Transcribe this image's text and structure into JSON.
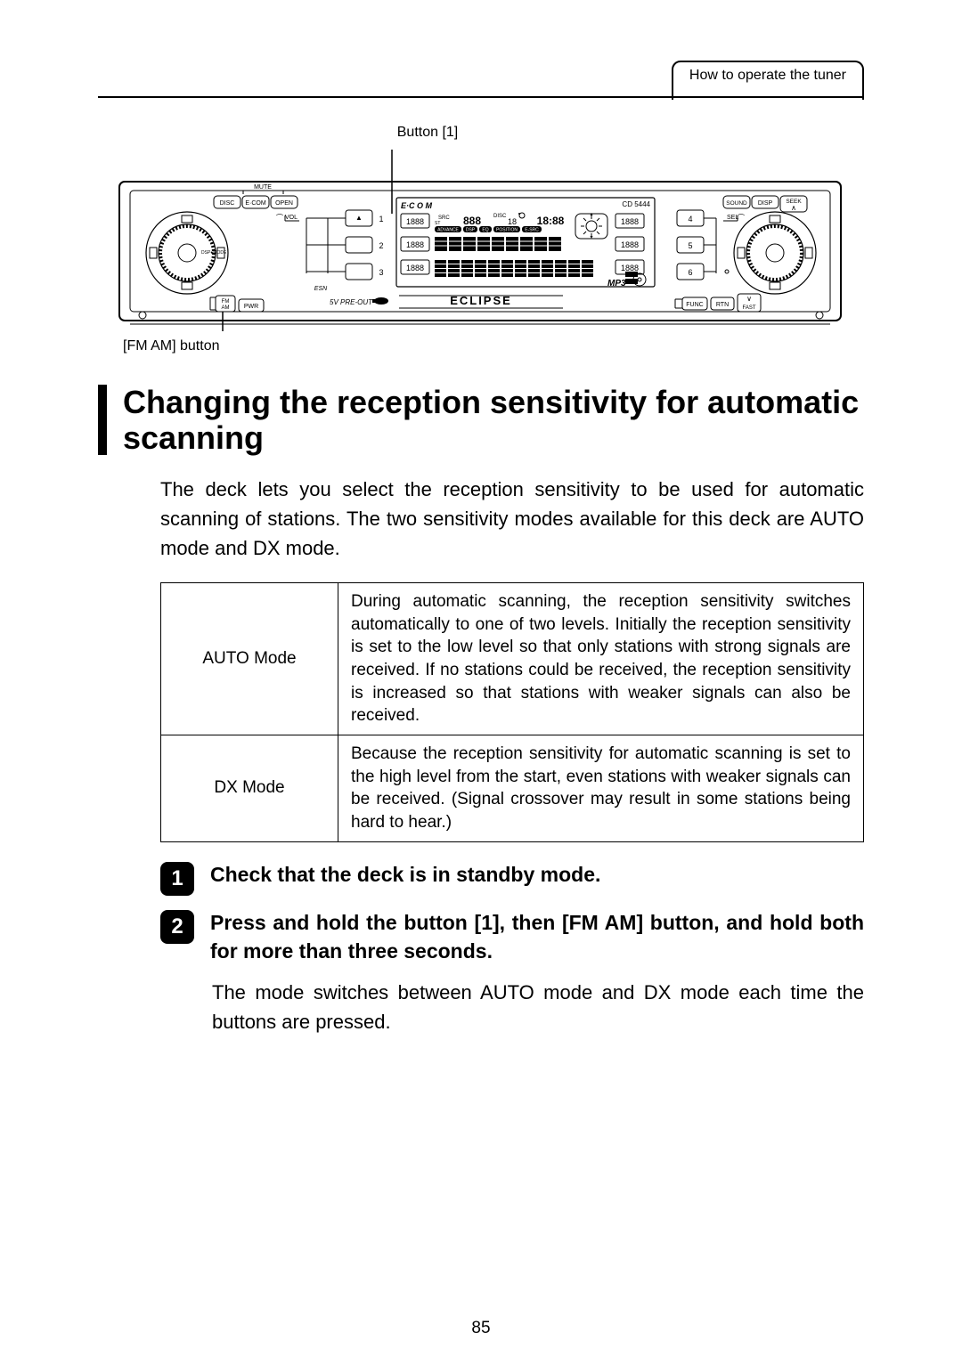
{
  "header": {
    "section_label": "How to operate the tuner"
  },
  "figure": {
    "top_label": "Button [1]",
    "bottom_label": "[FM AM] button",
    "device": {
      "model": "CD 5444",
      "brand": "ECLIPSE",
      "labels": {
        "mute": "MUTE",
        "disc": "DISC",
        "ecom": "E·COM",
        "open": "OPEN",
        "sound": "SOUND",
        "disp": "DISP",
        "seek_up": "SEEK",
        "vol": "VOL",
        "sel": "SEL",
        "esn": "ESN",
        "fm": "FM",
        "am": "AM",
        "pwr": "PWR",
        "preset1": "1",
        "preset2": "2",
        "preset3": "3",
        "preset4": "4",
        "preset5": "5",
        "preset6": "6",
        "eject_glyph": "▲",
        "preout": "5V PRE-OUT",
        "func": "FUNC",
        "rtn": "RTN",
        "fast": "FAST",
        "mp3": "MP3",
        "st": "ST",
        "src": "SRC",
        "disc_ind": "DISC",
        "advance": "ADVANCE",
        "dsp": "DSP",
        "eq": "EQ",
        "position": "POSITION",
        "esrc": "E-SRC",
        "lcd_time": "18:88",
        "lcd_seg": "1888"
      }
    }
  },
  "section_title": "Changing the reception sensitivity for automatic scanning",
  "intro": "The deck lets you select the reception sensitivity to be used for automatic scanning of stations. The two sensitivity modes available for this deck are AUTO mode and DX mode.",
  "modes": [
    {
      "name": "AUTO Mode",
      "description": "During automatic scanning, the reception sensitivity switches automatically to one of two levels. Initially the reception sensitivity is set to the low level so that only stations with strong signals are received. If no stations could be received, the reception sensitivity is increased so that stations with weaker signals can also be received."
    },
    {
      "name": "DX Mode",
      "description": "Because the reception sensitivity for automatic scanning is set to the high level from the start, even stations with weaker signals can be received. (Signal crossover may result in some stations being hard to hear.)"
    }
  ],
  "steps": [
    {
      "num": "1",
      "text": "Check that the deck is in standby mode."
    },
    {
      "num": "2",
      "text": "Press and hold the button [1], then [FM AM] button, and hold both for more than three seconds."
    }
  ],
  "followup": "The mode switches between AUTO mode and DX mode each time the buttons are pressed.",
  "page_number": "85"
}
